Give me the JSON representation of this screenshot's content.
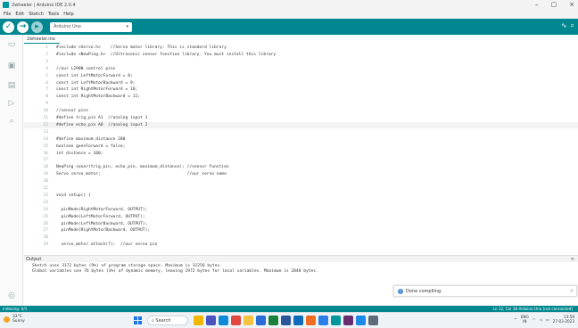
{
  "window": {
    "title": "2wheeler | Arduino IDE 2.0.4",
    "controls": [
      "–",
      "▢",
      "×"
    ]
  },
  "menu": [
    "File",
    "Edit",
    "Sketch",
    "Tools",
    "Help"
  ],
  "toolbar": {
    "board": "Arduino Uno",
    "verify_icon": "check-icon",
    "upload_icon": "arrow-right-icon",
    "debug_icon": "debug-icon"
  },
  "sidebar_icons": [
    "folder-icon",
    "boards-icon",
    "library-icon",
    "debug-icon",
    "search-icon"
  ],
  "file_tab": "2wheeler.ino",
  "code": [
    {
      "n": "1",
      "t": "#include <Servo.h>    //Servo motor library. This is standard library"
    },
    {
      "n": "2",
      "t": "#include <NewPing.h>  //Ultrasonic sensor function library. You must install this library"
    },
    {
      "n": "3",
      "t": ""
    },
    {
      "n": "4",
      "t": "//our L298N control pins"
    },
    {
      "n": "5",
      "t": "const int LeftMotorForward = 8;"
    },
    {
      "n": "6",
      "t": "const int LeftMotorBackward = 9;"
    },
    {
      "n": "7",
      "t": "const int RightMotorForward = 10;"
    },
    {
      "n": "8",
      "t": "const int RightMotorBackward = 11;"
    },
    {
      "n": "9",
      "t": ""
    },
    {
      "n": "10",
      "t": "//sensor pins"
    },
    {
      "n": "11",
      "t": "#define trig_pin A1  //analog input 1"
    },
    {
      "n": "12",
      "t": "#define echo_pin A0  //analog input 2"
    },
    {
      "n": "13",
      "t": ""
    },
    {
      "n": "14",
      "t": "#define maximum_distance 200"
    },
    {
      "n": "15",
      "t": "boolean goesForward = false;"
    },
    {
      "n": "16",
      "t": "int distance = 100;"
    },
    {
      "n": "17",
      "t": ""
    },
    {
      "n": "18",
      "t": "NewPing sonar(trig_pin, echo_pin, maximum_distance); //sensor function"
    },
    {
      "n": "19",
      "t": "Servo servo_motor;                                   //our servo name"
    },
    {
      "n": "20",
      "t": ""
    },
    {
      "n": "21",
      "t": ""
    },
    {
      "n": "22",
      "t": "void setup() {"
    },
    {
      "n": "23",
      "t": ""
    },
    {
      "n": "24",
      "t": "  pinMode(RightMotorForward, OUTPUT);"
    },
    {
      "n": "25",
      "t": "  pinMode(LeftMotorForward, OUTPUT);"
    },
    {
      "n": "26",
      "t": "  pinMode(LeftMotorBackward, OUTPUT);"
    },
    {
      "n": "27",
      "t": "  pinMode(RightMotorBackward, OUTPUT);"
    },
    {
      "n": "28",
      "t": ""
    },
    {
      "n": "29",
      "t": "  servo_motor.attach(7);  //our servo pin"
    }
  ],
  "active_line": "12",
  "output": {
    "label": "Output",
    "lines": [
      "Sketch uses 3172 bytes (9%) of program storage space. Maximum is 32256 bytes.",
      "Global variables use 76 bytes (3%) of dynamic memory, leaving 1972 bytes for local variables. Maximum is 2048 bytes."
    ]
  },
  "toast": {
    "text": "Done compiling.",
    "icon": "info-icon"
  },
  "status": {
    "left": "indexing: 0/1",
    "right": "Ln 12, Col 38   Arduino Uno [not connected]"
  },
  "taskbar": {
    "weather_temp": "33°C",
    "weather_desc": "Sunny",
    "search": "Search",
    "lang": "ENG",
    "region": "IN",
    "time": "13:59",
    "date": "27-03-2023",
    "icons": [
      {
        "name": "explorer-icon",
        "color": "#f2b705"
      },
      {
        "name": "teams-icon",
        "color": "#4b53bc"
      },
      {
        "name": "edge-icon",
        "color": "#0c8ad9"
      },
      {
        "name": "chrome-icon",
        "color": "#e2483d"
      },
      {
        "name": "files-icon",
        "color": "#f5c242"
      },
      {
        "name": "store-icon",
        "color": "#2b6cd4"
      },
      {
        "name": "app-icon",
        "color": "#1a7f3c"
      },
      {
        "name": "word-icon",
        "color": "#2b579a"
      },
      {
        "name": "outlook-icon",
        "color": "#0f6cbd"
      },
      {
        "name": "mail-icon",
        "color": "#ef6c22"
      },
      {
        "name": "photos-icon",
        "color": "#2a7ee8"
      },
      {
        "name": "arduino-icon",
        "color": "#00979c"
      },
      {
        "name": "slack-icon",
        "color": "#6a2c70"
      },
      {
        "name": "vscode-icon",
        "color": "#1e88e5"
      },
      {
        "name": "settings-icon",
        "color": "#5f6b7a"
      }
    ]
  }
}
